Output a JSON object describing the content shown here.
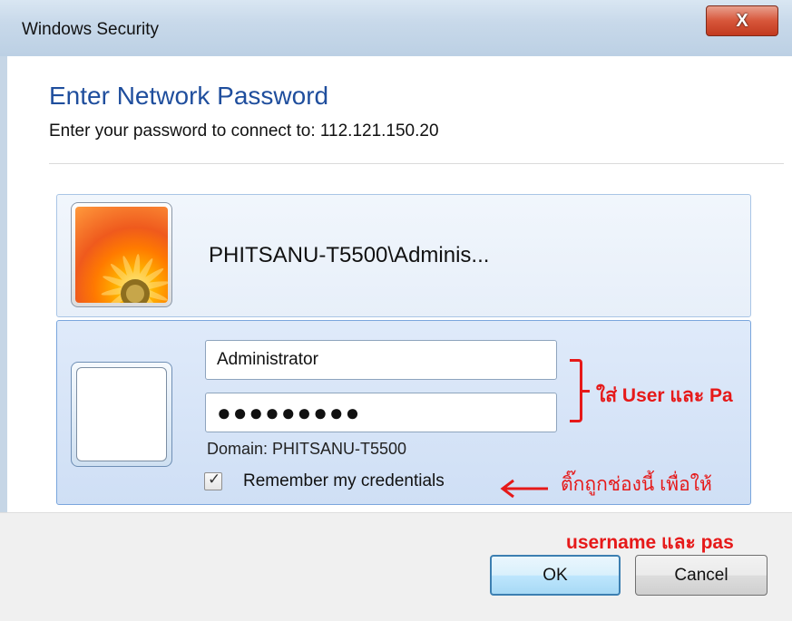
{
  "window": {
    "title": "Windows Security",
    "close_symbol": "X"
  },
  "header": {
    "heading": "Enter Network Password",
    "subtitle": "Enter your password to connect to: 112.121.150.20"
  },
  "account": {
    "name": "PHITSANU-T5500\\Adminis..."
  },
  "form": {
    "username_value": "Administrator",
    "password_value": "●●●●●●●●●",
    "domain": "Domain: PHITSANU-T5500",
    "remember_label": "Remember my credentials",
    "remember_checked": true,
    "check_symbol": "✓"
  },
  "annotations": {
    "fill_in": "ใส่ User และ Pa",
    "tick_box": "ติ๊กถูกช่องนี้ เพื่อให้",
    "remember_text": "username และ pas"
  },
  "buttons": {
    "ok": "OK",
    "cancel": "Cancel"
  },
  "colors": {
    "annotation": "#e61919",
    "heading": "#1f4e9d",
    "close_button": "#c8452b"
  },
  "icons": [
    "close-icon",
    "flower-avatar-icon",
    "blank-avatar-icon",
    "checkbox-icon",
    "red-arrow-icon",
    "red-bracket-icon"
  ]
}
